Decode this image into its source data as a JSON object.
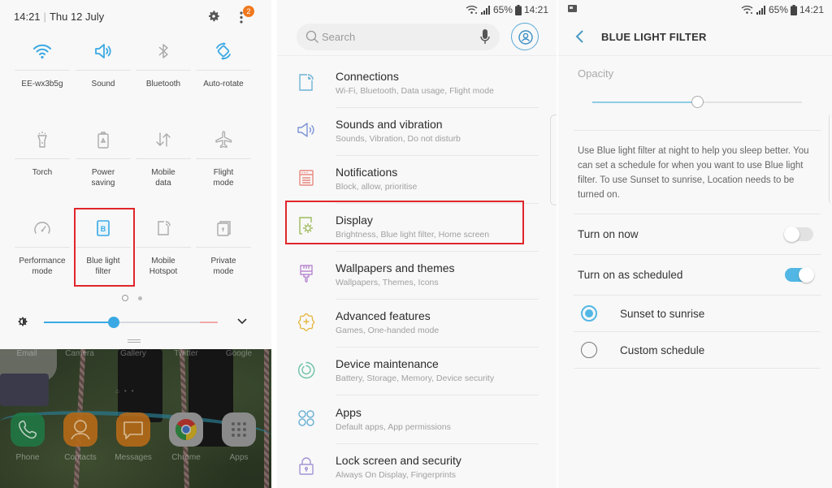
{
  "quick_panel": {
    "time": "14:21",
    "date": "Thu 12 July",
    "notification_count": "2",
    "tiles": [
      {
        "id": "wifi",
        "label": "EE-wx3b5g",
        "icon": "wifi-icon",
        "active": true
      },
      {
        "id": "sound",
        "label": "Sound",
        "icon": "speaker-icon",
        "active": true
      },
      {
        "id": "bluetooth",
        "label": "Bluetooth",
        "icon": "bluetooth-icon",
        "active": false
      },
      {
        "id": "autorotate",
        "label": "Auto-rotate",
        "icon": "rotate-icon",
        "active": true
      },
      {
        "id": "torch",
        "label": "Torch",
        "icon": "torch-icon",
        "active": false
      },
      {
        "id": "power",
        "label": "Power saving",
        "label_lines": [
          "Power",
          "saving"
        ],
        "icon": "battery-recycle-icon",
        "active": false
      },
      {
        "id": "data",
        "label": "Mobile data",
        "label_lines": [
          "Mobile",
          "data"
        ],
        "icon": "data-arrows-icon",
        "active": false
      },
      {
        "id": "flight",
        "label": "Flight mode",
        "label_lines": [
          "Flight",
          "mode"
        ],
        "icon": "airplane-icon",
        "active": false
      },
      {
        "id": "performance",
        "label": "Performance mode",
        "label_lines": [
          "Performance",
          "mode"
        ],
        "icon": "speedometer-icon",
        "active": false
      },
      {
        "id": "bluelight",
        "label": "Blue light filter",
        "label_lines": [
          "Blue light",
          "filter"
        ],
        "icon": "blue-light-icon",
        "active": true,
        "highlighted": true
      },
      {
        "id": "hotspot",
        "label": "Mobile Hotspot",
        "label_lines": [
          "Mobile",
          "Hotspot"
        ],
        "icon": "hotspot-icon",
        "active": false
      },
      {
        "id": "private",
        "label": "Private mode",
        "label_lines": [
          "Private",
          "mode"
        ],
        "icon": "private-lock-icon",
        "active": false
      }
    ],
    "page_indicator": {
      "current": 1,
      "total": 2
    },
    "brightness": 0.4,
    "tile_letter": "B"
  },
  "home_screen": {
    "top_row_labels": [
      "Email",
      "Camera",
      "Gallery",
      "Twitter",
      "Google"
    ],
    "dock": [
      {
        "label": "Phone",
        "color": "#1f9a55"
      },
      {
        "label": "Contacts",
        "color": "#e88a1e"
      },
      {
        "label": "Messages",
        "color": "#e88a1e"
      },
      {
        "label": "Chrome",
        "color": "#eeeeee"
      },
      {
        "label": "Apps",
        "color": "#e8e8e8"
      }
    ]
  },
  "status_bar": {
    "battery": "65%",
    "time": "14:21"
  },
  "settings": {
    "search_placeholder": "Search",
    "items": [
      {
        "title": "Connections",
        "subtitle": "Wi-Fi, Bluetooth, Data usage, Flight mode",
        "icon": "connections-icon",
        "color": "#6eb3d6"
      },
      {
        "title": "Sounds and vibration",
        "subtitle": "Sounds, Vibration, Do not disturb",
        "icon": "sound-icon",
        "color": "#7c93d6"
      },
      {
        "title": "Notifications",
        "subtitle": "Block, allow, prioritise",
        "icon": "notifications-icon",
        "color": "#e8887f"
      },
      {
        "title": "Display",
        "subtitle": "Brightness, Blue light filter, Home screen",
        "icon": "display-icon",
        "color": "#9cbb5a",
        "highlighted": true
      },
      {
        "title": "Wallpapers and themes",
        "subtitle": "Wallpapers, Themes, Icons",
        "icon": "brush-icon",
        "color": "#b888d0"
      },
      {
        "title": "Advanced features",
        "subtitle": "Games, One-handed mode",
        "icon": "advanced-gear-icon",
        "color": "#e6b845"
      },
      {
        "title": "Device maintenance",
        "subtitle": "Battery, Storage, Memory, Device security",
        "icon": "maintenance-icon",
        "color": "#6cc2a8"
      },
      {
        "title": "Apps",
        "subtitle": "Default apps, App permissions",
        "icon": "apps-icon",
        "color": "#6eb3d6"
      },
      {
        "title": "Lock screen and security",
        "subtitle": "Always On Display, Fingerprints",
        "icon": "lock-icon",
        "color": "#a394d6"
      }
    ]
  },
  "blue_light_filter": {
    "title": "BLUE LIGHT FILTER",
    "opacity_label": "Opacity",
    "opacity_value": 0.5,
    "description": "Use Blue light filter at night to help you sleep better. You can set a schedule for when you want to use Blue light filter. To use Sunset to sunrise, Location needs to be turned on.",
    "turn_on_now": {
      "label": "Turn on now",
      "on": false
    },
    "turn_on_scheduled": {
      "label": "Turn on as scheduled",
      "on": true
    },
    "schedule_options": [
      {
        "label": "Sunset to sunrise",
        "selected": true
      },
      {
        "label": "Custom schedule",
        "selected": false
      }
    ]
  },
  "colors": {
    "accent": "#3aa9e3",
    "highlight_box": "#e0262b",
    "badge": "#f0781e"
  }
}
